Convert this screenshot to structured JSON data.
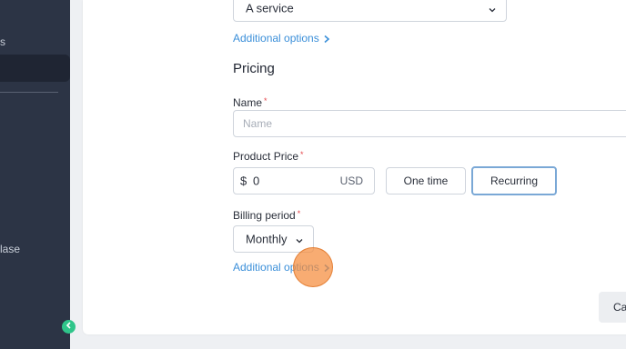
{
  "sidebar": {
    "items": [
      {
        "label": "s"
      },
      {
        "label": "lase"
      }
    ],
    "collapse_icon": "chevron-left-icon",
    "collapse_color": "#2fc58a"
  },
  "form": {
    "service_select": {
      "value": "A service"
    },
    "additional_options_1": "Additional options",
    "pricing_heading": "Pricing",
    "name_label": "Name",
    "required_mark": "*",
    "name_placeholder": "Name",
    "price_label": "Product Price",
    "price": {
      "currency_symbol": "$",
      "value": "0",
      "unit": "USD"
    },
    "one_time_button": "One time",
    "recurring_button": "Recurring",
    "billing_label": "Billing period",
    "billing_select": {
      "value": "Monthly"
    },
    "additional_options_2": "Additional options",
    "cancel_button": "Ca"
  },
  "colors": {
    "accent_link": "#3b8fd9",
    "required": "#e5484d",
    "selected_border": "#7aa8d6"
  }
}
